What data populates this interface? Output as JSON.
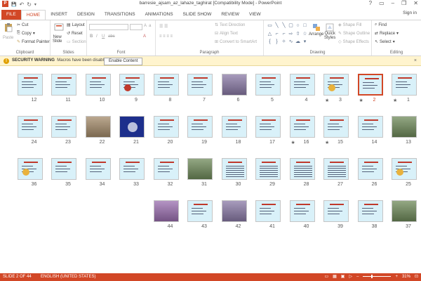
{
  "window": {
    "app_icon": "P",
    "title": "barresie_ajsam_az_lahaze_taghirat [Compatibility Mode] - PowerPoint",
    "minimize": "–",
    "restore": "❐",
    "close": "✕",
    "help": "?",
    "ribbon_options": "▭"
  },
  "qat": {
    "save": "💾",
    "undo": "↶",
    "redo": "↻",
    "customize": "▾"
  },
  "tabs": [
    "FILE",
    "HOME",
    "INSERT",
    "DESIGN",
    "TRANSITIONS",
    "ANIMATIONS",
    "SLIDE SHOW",
    "REVIEW",
    "VIEW"
  ],
  "active_tab": "HOME",
  "signin": "Sign in",
  "ribbon": {
    "clipboard": {
      "label": "Clipboard",
      "paste": "Paste",
      "cut": "Cut",
      "copy": "Copy",
      "format_painter": "Format Painter"
    },
    "slides": {
      "label": "Slides",
      "new_slide_1": "New",
      "new_slide_2": "Slide",
      "layout": "Layout",
      "reset": "Reset",
      "section": "Section"
    },
    "font": {
      "label": "Font"
    },
    "paragraph": {
      "label": "Paragraph",
      "text_direction": "Text Direction",
      "align_text": "Align Text",
      "convert": "Convert to SmartArt"
    },
    "drawing": {
      "label": "Drawing",
      "arrange": "Arrange",
      "quick_styles_1": "Quick",
      "quick_styles_2": "Styles",
      "shape_fill": "Shape Fill",
      "shape_outline": "Shape Outline",
      "shape_effects": "Shape Effects"
    },
    "editing": {
      "label": "Editing",
      "find": "Find",
      "replace": "Replace",
      "select": "Select"
    }
  },
  "security": {
    "title": "SECURITY WARNING",
    "message": "Macros have been disabled.",
    "button": "Enable Content",
    "close": "×"
  },
  "slides": [
    {
      "n": "1",
      "star": true,
      "kind": "text"
    },
    {
      "n": "2",
      "star": true,
      "kind": "text",
      "selected": true
    },
    {
      "n": "3",
      "star": true,
      "kind": "diagram"
    },
    {
      "n": "4",
      "star": false,
      "kind": "text"
    },
    {
      "n": "5",
      "star": false,
      "kind": "text"
    },
    {
      "n": "6",
      "star": false,
      "kind": "photo"
    },
    {
      "n": "7",
      "star": false,
      "kind": "text"
    },
    {
      "n": "8",
      "star": false,
      "kind": "text"
    },
    {
      "n": "9",
      "star": false,
      "kind": "chart"
    },
    {
      "n": "10",
      "star": false,
      "kind": "text"
    },
    {
      "n": "11",
      "star": false,
      "kind": "text"
    },
    {
      "n": "12",
      "star": false,
      "kind": "text"
    },
    {
      "n": "13",
      "star": false,
      "kind": "photo"
    },
    {
      "n": "14",
      "star": false,
      "kind": "text"
    },
    {
      "n": "15",
      "star": true,
      "kind": "text"
    },
    {
      "n": "16",
      "star": true,
      "kind": "text"
    },
    {
      "n": "17",
      "star": false,
      "kind": "text"
    },
    {
      "n": "18",
      "star": false,
      "kind": "text"
    },
    {
      "n": "19",
      "star": false,
      "kind": "text"
    },
    {
      "n": "20",
      "star": false,
      "kind": "text"
    },
    {
      "n": "21",
      "star": false,
      "kind": "dark"
    },
    {
      "n": "22",
      "star": false,
      "kind": "photo"
    },
    {
      "n": "23",
      "star": false,
      "kind": "text"
    },
    {
      "n": "24",
      "star": false,
      "kind": "text"
    },
    {
      "n": "25",
      "star": false,
      "kind": "diagram"
    },
    {
      "n": "26",
      "star": false,
      "kind": "text"
    },
    {
      "n": "27",
      "star": false,
      "kind": "table"
    },
    {
      "n": "28",
      "star": false,
      "kind": "table"
    },
    {
      "n": "29",
      "star": false,
      "kind": "table"
    },
    {
      "n": "30",
      "star": false,
      "kind": "table"
    },
    {
      "n": "31",
      "star": false,
      "kind": "photo"
    },
    {
      "n": "32",
      "star": false,
      "kind": "text"
    },
    {
      "n": "33",
      "star": false,
      "kind": "text"
    },
    {
      "n": "34",
      "star": false,
      "kind": "text"
    },
    {
      "n": "35",
      "star": false,
      "kind": "text"
    },
    {
      "n": "36",
      "star": false,
      "kind": "diagram"
    },
    {
      "n": "37",
      "star": false,
      "kind": "photo"
    },
    {
      "n": "38",
      "star": false,
      "kind": "text"
    },
    {
      "n": "39",
      "star": false,
      "kind": "text"
    },
    {
      "n": "40",
      "star": false,
      "kind": "text"
    },
    {
      "n": "41",
      "star": false,
      "kind": "text"
    },
    {
      "n": "42",
      "star": false,
      "kind": "photo"
    },
    {
      "n": "43",
      "star": false,
      "kind": "text"
    },
    {
      "n": "44",
      "star": false,
      "kind": "photo"
    }
  ],
  "status": {
    "slide": "SLIDE 2 OF 44",
    "language": "ENGLISH (UNITED STATES)",
    "zoom": "31%",
    "zoom_out": "–",
    "zoom_in": "+",
    "fit": "⊡",
    "zoom_value": 0.31
  },
  "colors": {
    "accent": "#d24726",
    "slide_bg": "#d9f1f9",
    "warn_bg": "#fff4ce"
  }
}
